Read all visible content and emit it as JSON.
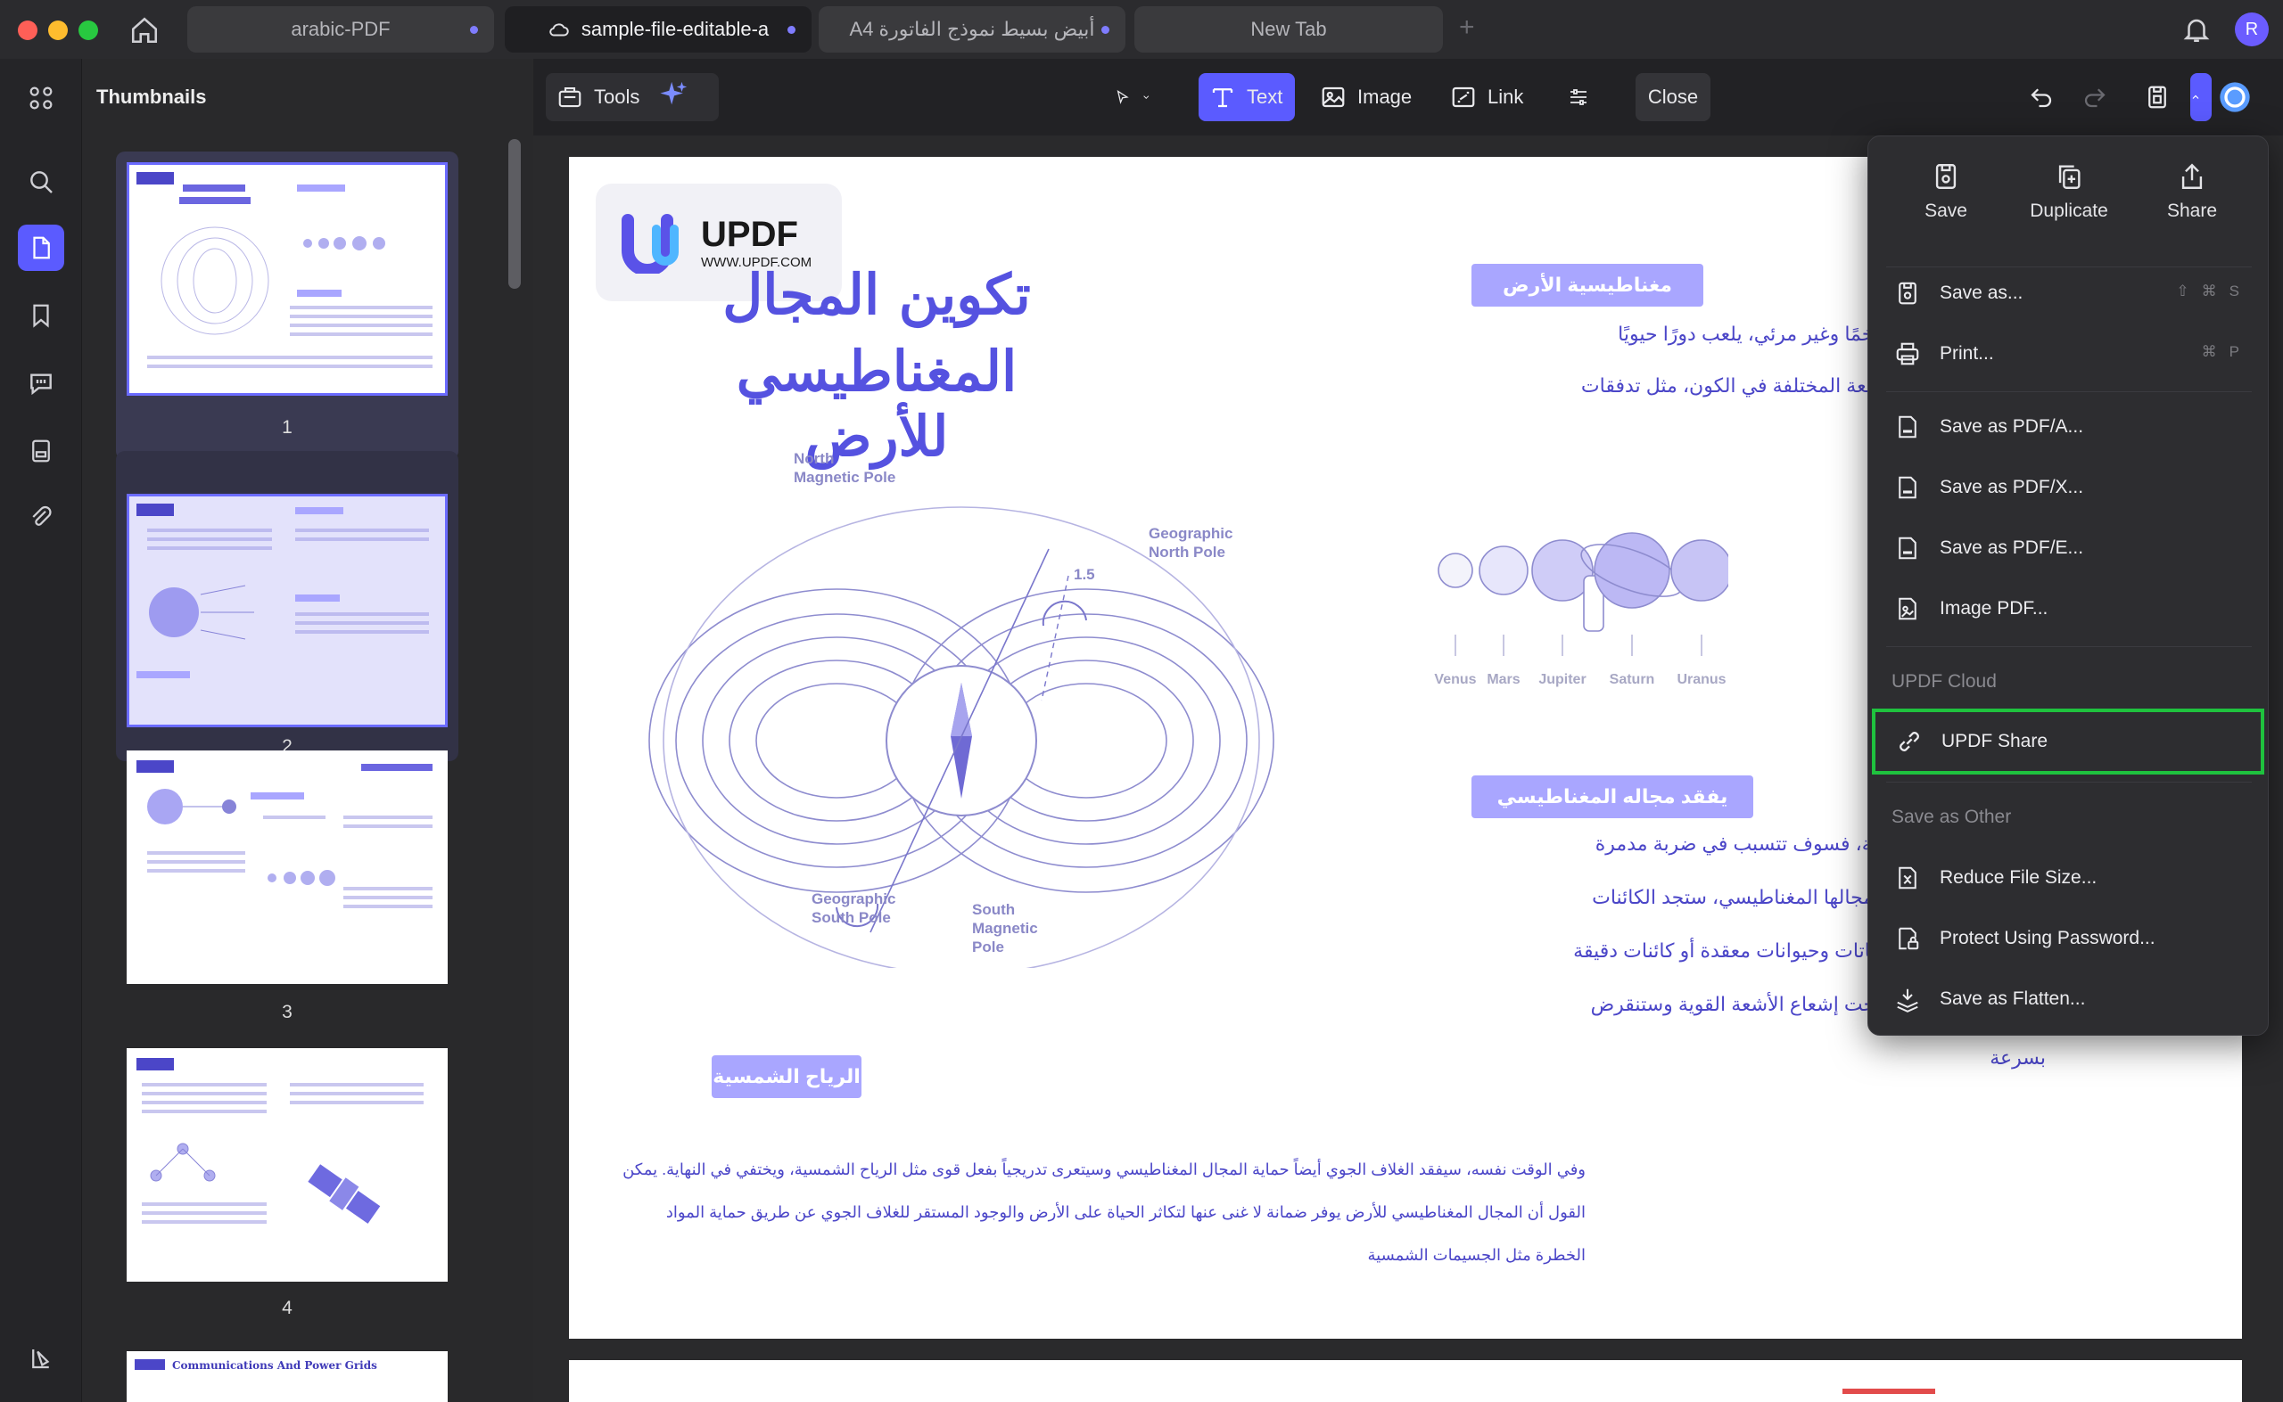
{
  "tabs": [
    {
      "title": "arabic-PDF"
    },
    {
      "title": "sample-file-editable-a"
    },
    {
      "title": "A4 أبيض بسيط نموذج الفاتورة"
    },
    {
      "title": "New Tab"
    }
  ],
  "user": {
    "initial": "R"
  },
  "sidebar": {
    "title": "Thumbnails",
    "pages": [
      "1",
      "2",
      "3",
      "4"
    ],
    "page5_heading": "Communications And Power Grids"
  },
  "toolbar": {
    "tools_label": "Tools",
    "text_label": "Text",
    "image_label": "Image",
    "link_label": "Link",
    "close_label": "Close"
  },
  "document": {
    "logo": {
      "name": "UPDF",
      "url": "WWW.UPDF.COM"
    },
    "title_line1": "تكوين المجال",
    "title_line2": "المغناطيسي للأرض",
    "badge1": "مغناطيسية الأرض",
    "badge1_lines": [
      "يشبه درعًا واقيًا ضخمًا وغير مرئي، يلعب دورًا حيويًا",
      "ية معظم أنواع الأشعة المختلفة في الكون، مثل تدفقات"
    ],
    "planets": [
      "Venus",
      "Mars",
      "Jupiter",
      "Saturn",
      "Uranus"
    ],
    "diagram_labels": {
      "north_magnetic": "North\nMagnetic Pole",
      "geo_north": "Geographic\nNorth Pole",
      "geo_south": "Geographic\nSouth Pole",
      "south_magnetic": "South\nMagnetic\nPole",
      "angle": "1.5"
    },
    "badge2": "يفقد مجاله المغناطيسي",
    "badge2_lines": [
      "ى الأرض دون إعاقة، فسوف تتسبب في ضربة مدمرة",
      "رد أن تفقد الأرض مجالها المغناطيسي، ستجد الكائنات",
      "رض، سواء كانت نباتات وحيوانات معقدة أو كائنات دقيقة",
      "ء على قيد الحياة تحت إشعاع الأشعة القوية وستنقرض",
      "بسرعة"
    ],
    "badge3": "الرياح الشمسية",
    "para_lines": [
      "وفي الوقت نفسه، سيفقد الغلاف الجوي أيضاً حماية المجال المغناطيسي وسيتعرى تدريجياً بفعل قوى مثل الرياح الشمسية، ويختفي في النهاية. يمكن",
      "القول أن المجال المغناطيسي للأرض يوفر ضمانة لا غنى عنها لتكاثر الحياة على الأرض والوجود المستقر للغلاف الجوي عن طريق حماية المواد",
      "الخطرة مثل الجسيمات الشمسية"
    ]
  },
  "menu": {
    "quick_actions": [
      "Save",
      "Duplicate",
      "Share"
    ],
    "items": [
      {
        "label": "Save as...",
        "shortcut": [
          "⇧",
          "⌘",
          "S"
        ]
      },
      {
        "label": "Print...",
        "shortcut": [
          "⌘",
          "P"
        ]
      },
      {
        "label": "Save as PDF/A..."
      },
      {
        "label": "Save as PDF/X..."
      },
      {
        "label": "Save as PDF/E..."
      },
      {
        "label": "Image PDF..."
      }
    ],
    "cloud_header": "UPDF Cloud",
    "cloud_items": [
      {
        "label": "UPDF Share"
      }
    ],
    "other_header": "Save as Other",
    "other_items": [
      {
        "label": "Reduce File Size..."
      },
      {
        "label": "Protect Using Password..."
      },
      {
        "label": "Save as Flatten..."
      }
    ]
  }
}
